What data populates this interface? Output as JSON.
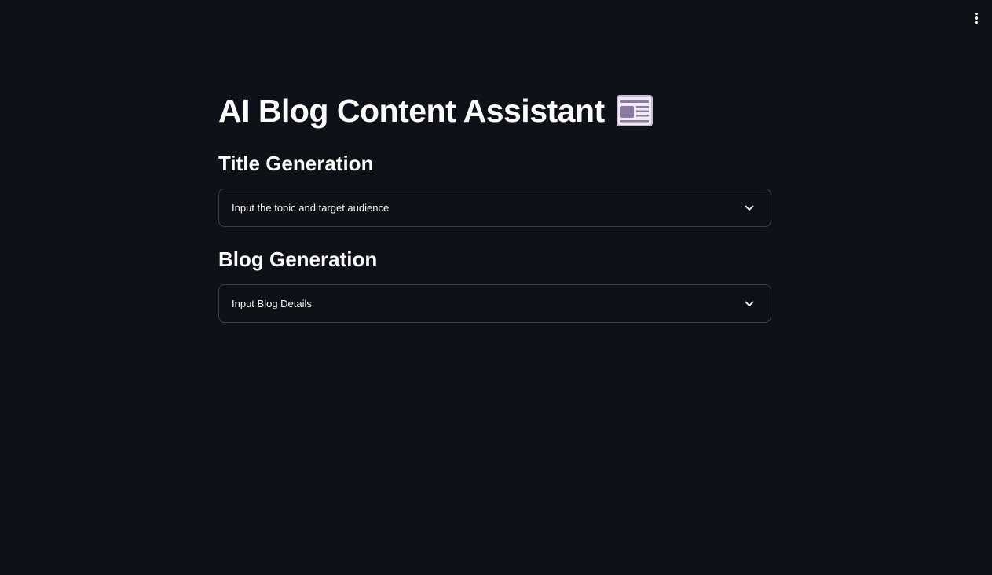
{
  "header": {
    "menu_icon": "vertical-ellipsis-icon"
  },
  "main": {
    "title": "AI Blog Content Assistant",
    "title_icon": "newspaper-icon",
    "sections": [
      {
        "heading": "Title Generation",
        "expander_label": "Input the topic and target audience",
        "expander_icon": "chevron-down-icon"
      },
      {
        "heading": "Blog Generation",
        "expander_label": "Input Blog Details",
        "expander_icon": "chevron-down-icon"
      }
    ]
  },
  "colors": {
    "background": "#0e1117",
    "text": "#fafafa",
    "border": "rgba(250,250,250,0.2)"
  }
}
